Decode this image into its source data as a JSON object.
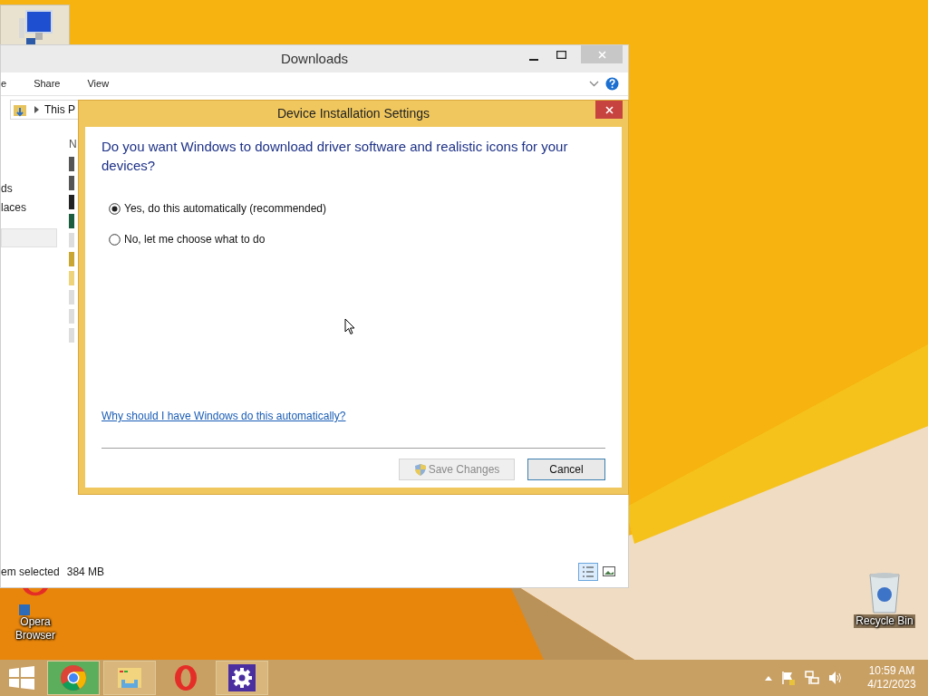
{
  "desktop": {
    "icons": [
      {
        "kind": "computer",
        "selected": true
      },
      {
        "kind": "opera",
        "label": "Opera Browser",
        "selected": false
      },
      {
        "kind": "recycle",
        "label": "Recycle Bin",
        "selected": false
      }
    ]
  },
  "explorer": {
    "title": "Downloads",
    "ribbon_tabs": [
      "e",
      "Share",
      "View"
    ],
    "address": "This P",
    "nav_items": [
      {
        "label": "ds",
        "selected": false
      },
      {
        "label": "laces",
        "selected": false
      },
      {
        "selected": true
      }
    ],
    "column_header": "N",
    "status": "em selected",
    "size": "384 MB"
  },
  "dialog": {
    "title": "Device Installation Settings",
    "question": "Do you want Windows to download driver software and realistic icons for your devices?",
    "options": [
      {
        "label": "Yes, do this automatically (recommended)",
        "selected": true
      },
      {
        "label": "No, let me choose what to do",
        "selected": false
      }
    ],
    "link": "Why should I have Windows do this automatically?",
    "save_button": {
      "label": "Save Changes",
      "disabled": true
    },
    "cancel_button": {
      "label": "Cancel"
    }
  },
  "taskbar": {
    "apps": [
      {
        "kind": "chrome",
        "running": true
      },
      {
        "kind": "explorer",
        "running": true
      },
      {
        "kind": "opera",
        "running": false
      },
      {
        "kind": "settings",
        "running": true
      }
    ],
    "time": "10:59 AM",
    "date": "4/12/2023"
  }
}
